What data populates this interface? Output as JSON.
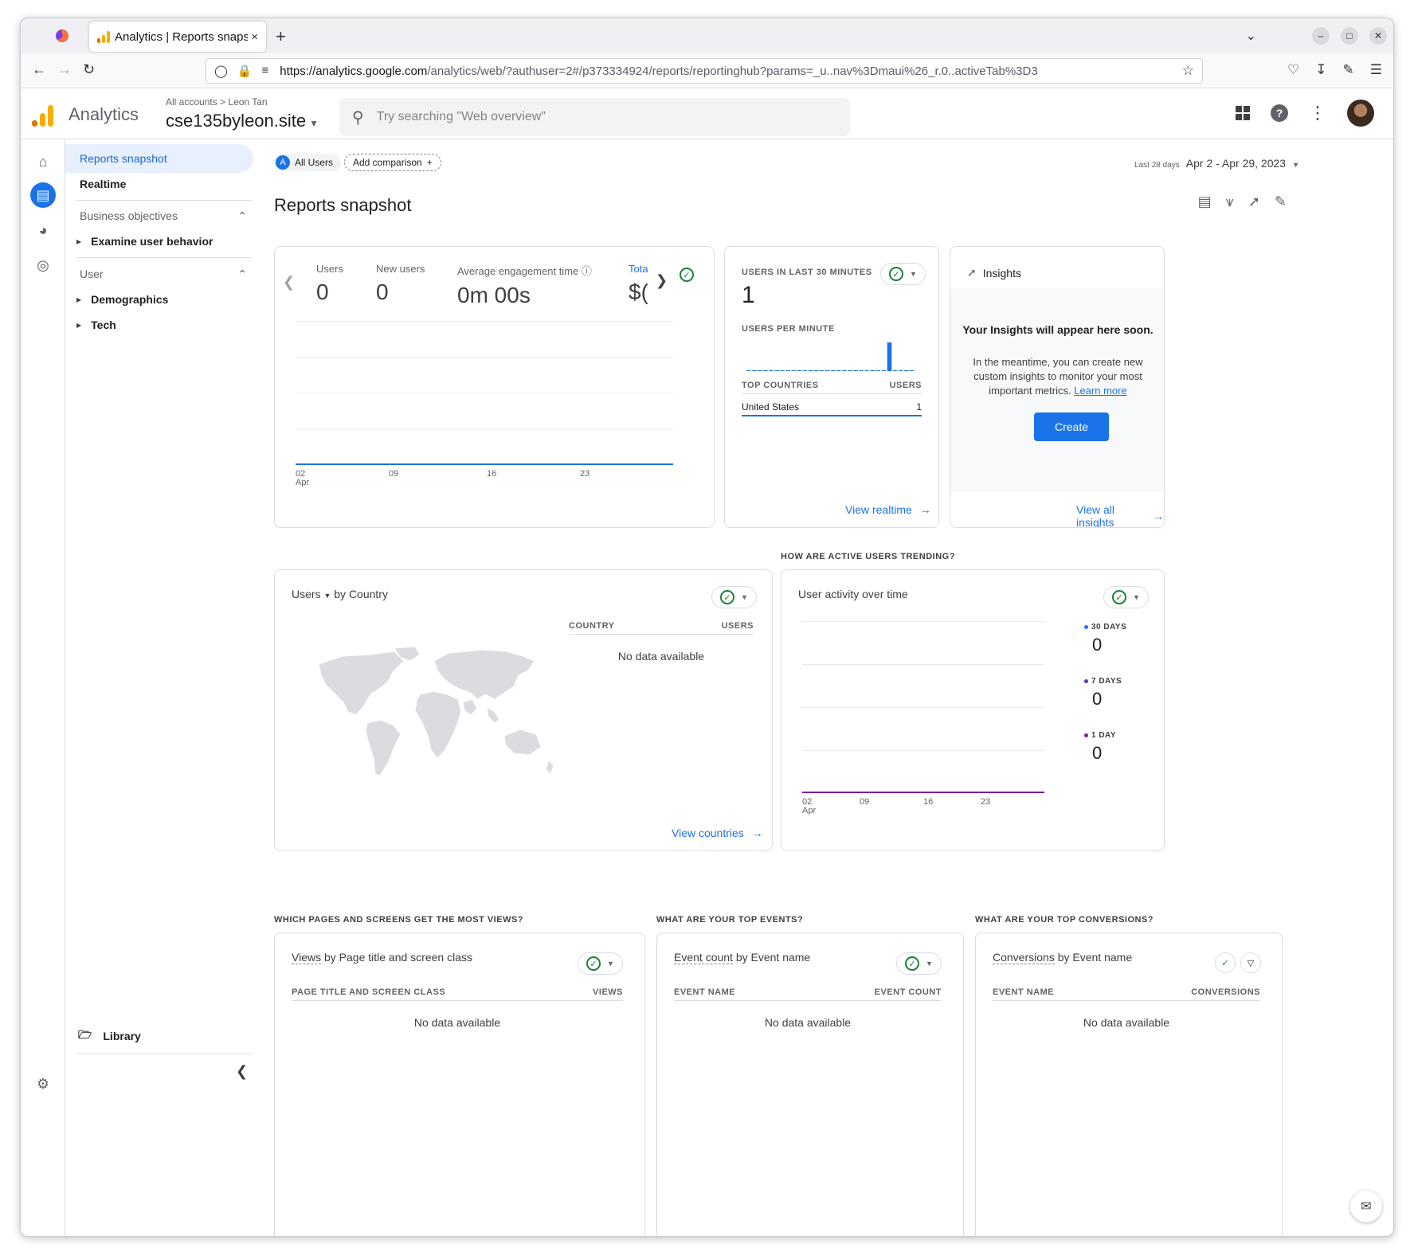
{
  "browser": {
    "tab_title": "Analytics | Reports snaps",
    "tab_close": "×",
    "new_tab": "+",
    "url_host": "https://analytics.google.com",
    "url_path": "/analytics/web/?authuser=2#/p373334924/reports/reportinghub?params=_u..nav%3Dmaui%26_r.0..activeTab%3D3"
  },
  "header": {
    "product": "Analytics",
    "crumb_all": "All accounts",
    "crumb_sep": ">",
    "crumb_account": "Leon Tan",
    "property": "cse135byleon.site",
    "search_placeholder": "Try searching \"Web overview\""
  },
  "sidebar": {
    "reports_snapshot": "Reports snapshot",
    "realtime": "Realtime",
    "section_business": "Business objectives",
    "examine": "Examine user behavior",
    "section_user": "User",
    "demographics": "Demographics",
    "tech": "Tech",
    "library": "Library"
  },
  "toolbar": {
    "all_users_badge": "A",
    "all_users": "All Users",
    "add_comparison": "Add comparison",
    "date_label": "Last 28 days",
    "date_range": "Apr 2 - Apr 29, 2023",
    "page_title": "Reports snapshot"
  },
  "overview_card": {
    "metrics": [
      {
        "label": "Users",
        "value": "0"
      },
      {
        "label": "New users",
        "value": "0"
      },
      {
        "label": "Average engagement time",
        "value": "0m 00s"
      },
      {
        "label": "Tota",
        "value": "$("
      }
    ],
    "x_ticks": [
      "02",
      "09",
      "16",
      "23"
    ],
    "x_month": "Apr"
  },
  "realtime_card": {
    "title": "USERS IN LAST 30 MINUTES",
    "value": "1",
    "per_minute": "USERS PER MINUTE",
    "top_countries": "TOP COUNTRIES",
    "users_col": "USERS",
    "row_country": "United States",
    "row_value": "1",
    "link": "View realtime",
    "per_minute_values": [
      0,
      0,
      0,
      0,
      0,
      0,
      0,
      0,
      0,
      0,
      0,
      0,
      0,
      0,
      0,
      0,
      0,
      0,
      0,
      0,
      0,
      0,
      0,
      0,
      0,
      1,
      0,
      0,
      0,
      0
    ]
  },
  "insights_card": {
    "title": "Insights",
    "headline": "Your Insights will appear here soon.",
    "body": "In the meantime, you can create new custom insights to monitor your most important metrics.",
    "learn_more": "Learn more",
    "create": "Create",
    "link": "View all insights"
  },
  "country_card": {
    "metric": "Users",
    "by": "by Country",
    "col_country": "COUNTRY",
    "col_users": "USERS",
    "no_data": "No data available",
    "link": "View countries"
  },
  "trend_section": {
    "heading": "HOW ARE ACTIVE USERS TRENDING?",
    "title": "User activity over time",
    "legend": [
      {
        "label": "30 DAYS",
        "value": "0",
        "color": "#1a73e8"
      },
      {
        "label": "7 DAYS",
        "value": "0",
        "color": "#5e35b1"
      },
      {
        "label": "1 DAY",
        "value": "0",
        "color": "#7b1fa2"
      }
    ],
    "x_ticks": [
      "02",
      "09",
      "16",
      "23"
    ],
    "x_month": "Apr"
  },
  "pages_section": {
    "heading": "WHICH PAGES AND SCREENS GET THE MOST VIEWS?",
    "title_metric": "Views",
    "title_by": "by Page title and screen class",
    "col_left": "PAGE TITLE AND SCREEN CLASS",
    "col_right": "VIEWS",
    "no_data": "No data available"
  },
  "events_section": {
    "heading": "WHAT ARE YOUR TOP EVENTS?",
    "title_metric": "Event count",
    "title_by": "by Event name",
    "col_left": "EVENT NAME",
    "col_right": "EVENT COUNT",
    "no_data": "No data available"
  },
  "conversions_section": {
    "heading": "WHAT ARE YOUR TOP CONVERSIONS?",
    "title_metric": "Conversions",
    "title_by": "by Event name",
    "col_left": "EVENT NAME",
    "col_right": "CONVERSIONS",
    "no_data": "No data available"
  },
  "colors": {
    "accent": "#1a73e8",
    "ga_orange": "#f9ab00",
    "ga_dark_orange": "#e37400",
    "check_green": "#188038"
  }
}
